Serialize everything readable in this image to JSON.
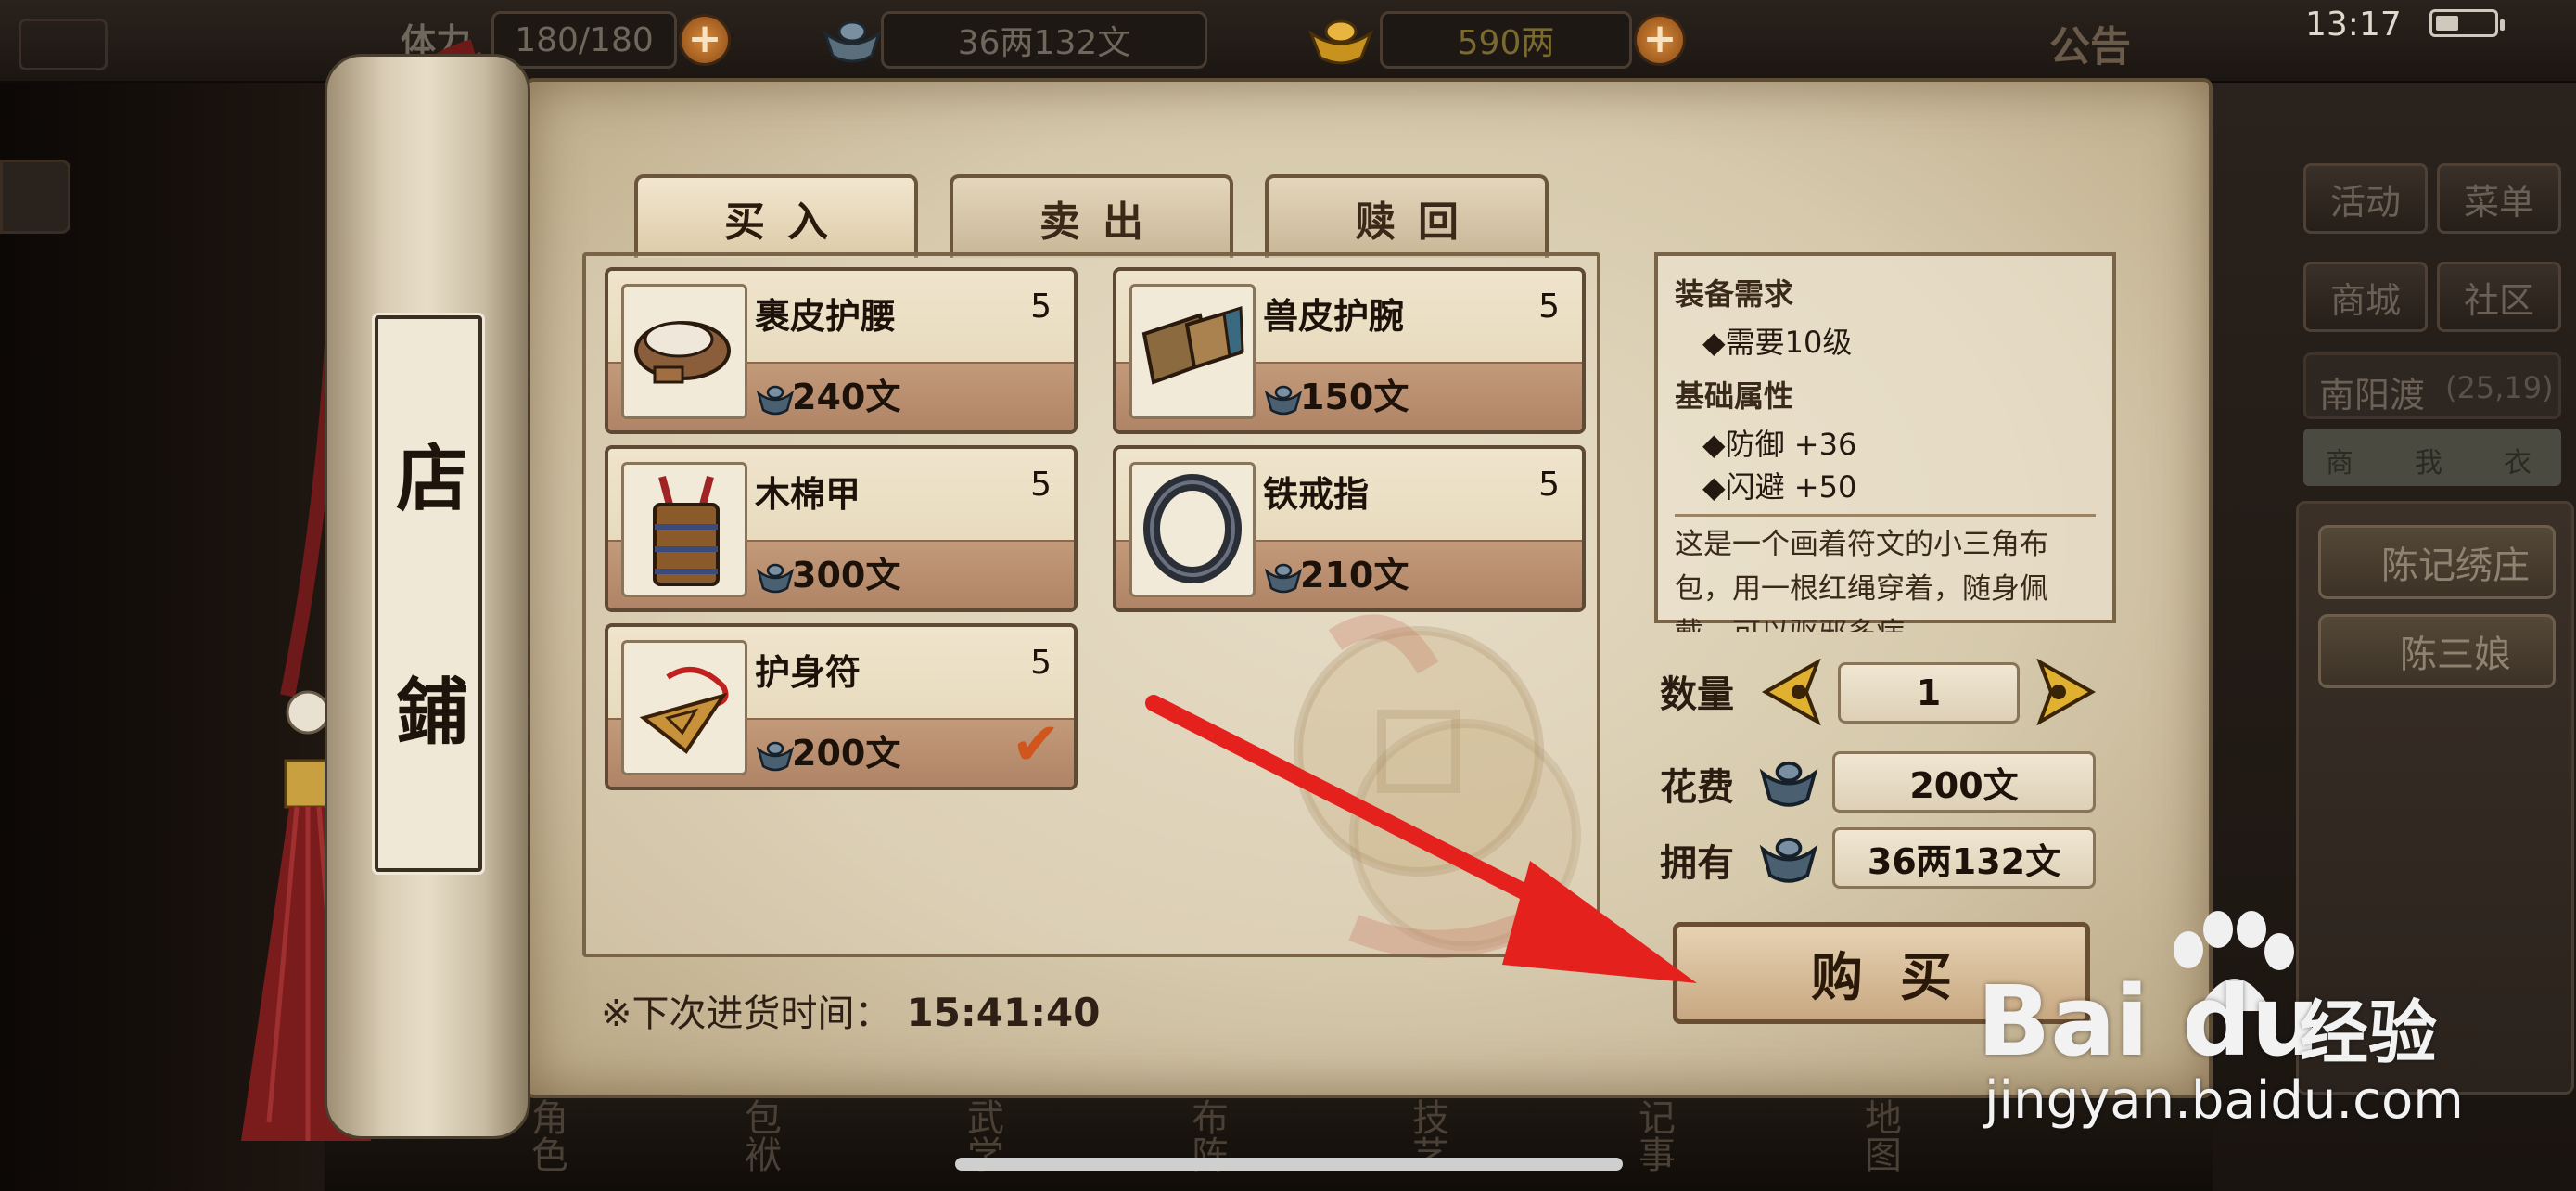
{
  "topbar": {
    "stamina_label": "体力",
    "stamina_value": "180/180",
    "silver_value": "36两132文",
    "gold_value": "590两",
    "notice": "公告",
    "time": "13:17"
  },
  "side_menu": {
    "items": [
      "活动",
      "菜单",
      "商城",
      "社区"
    ],
    "location_name": "南阳渡",
    "location_coords": "(25,19)",
    "shortcuts": [
      "商",
      "我",
      "衣"
    ],
    "npcs": [
      "陈记绣庄",
      "陈三娘"
    ]
  },
  "scroll": {
    "title_chars": [
      "店",
      "鋪"
    ]
  },
  "shop": {
    "tabs": [
      {
        "label": "买入",
        "active": true
      },
      {
        "label": "卖出",
        "active": false
      },
      {
        "label": "赎回",
        "active": false
      }
    ],
    "items": [
      {
        "name": "裹皮护腰",
        "qty": "5",
        "price": "240文",
        "icon": "leather-belt-icon",
        "selected": false
      },
      {
        "name": "兽皮护腕",
        "qty": "5",
        "price": "150文",
        "icon": "bracer-icon",
        "selected": false
      },
      {
        "name": "木棉甲",
        "qty": "5",
        "price": "300文",
        "icon": "cotton-armor-icon",
        "selected": false
      },
      {
        "name": "铁戒指",
        "qty": "5",
        "price": "210文",
        "icon": "iron-ring-icon",
        "selected": false
      },
      {
        "name": "护身符",
        "qty": "5",
        "price": "200文",
        "icon": "amulet-icon",
        "selected": true
      }
    ],
    "restock_label": "※下次进货时间：",
    "restock_time": "15:41:40"
  },
  "detail": {
    "req_header": "装备需求",
    "req_line": "◆需要10级",
    "attr_header": "基础属性",
    "attr_lines": [
      "◆防御 +36",
      "◆闪避 +50"
    ],
    "description": "这是一个画着符文的小三角布包，用一根红绳穿着，随身佩戴，可以驱邪多病"
  },
  "purchase": {
    "qty_label": "数量",
    "qty_value": "1",
    "cost_label": "花费",
    "cost_value": "200文",
    "own_label": "拥有",
    "own_value": "36两132文",
    "buy_label": "购买"
  },
  "bottom_nav": [
    "角色",
    "包袱",
    "武学",
    "布阵",
    "技艺",
    "记事",
    "地图"
  ],
  "watermark": {
    "brand": "Bai du",
    "product": "经验",
    "url": "jingyan.baidu.com"
  },
  "colors": {
    "parchment": "#d6c9ac",
    "selected_check": "#d0561e",
    "annotation_arrow": "#e4211d"
  }
}
